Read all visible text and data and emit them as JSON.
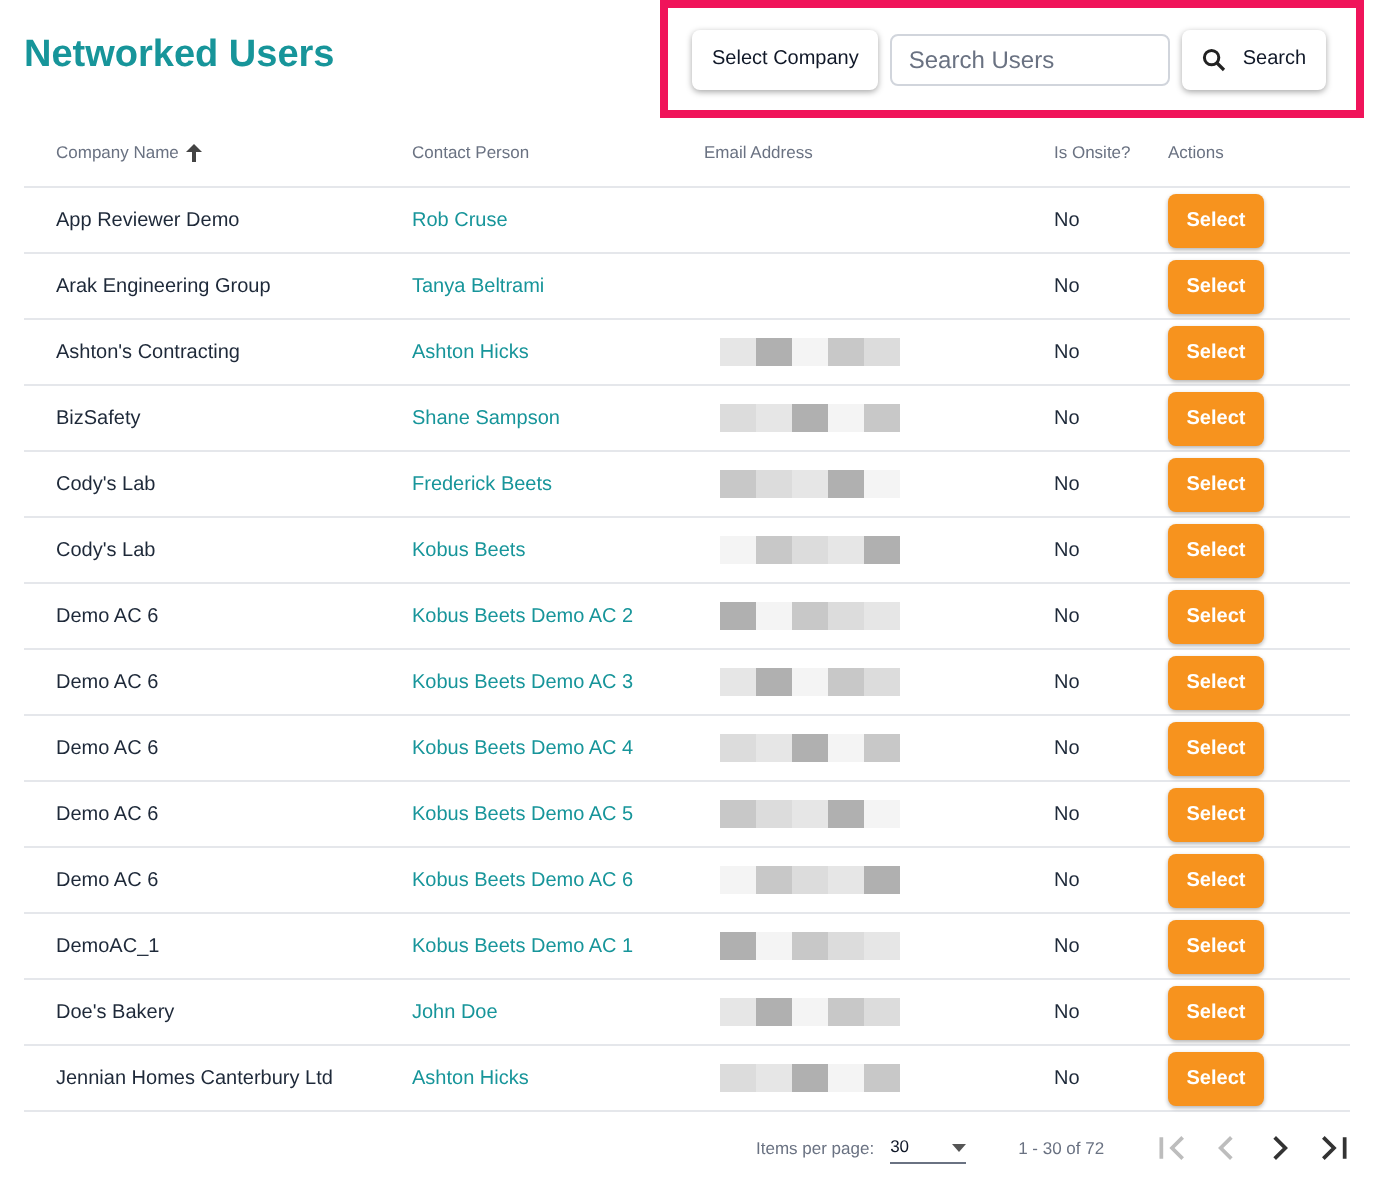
{
  "title": "Networked Users",
  "toolbar": {
    "select_company": "Select Company",
    "search": {
      "placeholder": "Search Users"
    },
    "search_button": "Search"
  },
  "table": {
    "columns": [
      {
        "label": "Company Name",
        "sorted": true
      },
      {
        "label": "Contact Person",
        "sorted": false
      },
      {
        "label": "Email Address",
        "sorted": false
      },
      {
        "label": "Is Onsite?",
        "sorted": false
      },
      {
        "label": "Actions",
        "sorted": false
      }
    ],
    "rows": [
      {
        "company": "App Reviewer Demo",
        "contact": "Rob Cruse",
        "onsite": "No",
        "action": "Select"
      },
      {
        "company": "Arak Engineering Group",
        "contact": "Tanya Beltrami",
        "onsite": "No",
        "action": "Select"
      },
      {
        "company": "Ashton's Contracting",
        "contact": "Ashton Hicks",
        "onsite": "No",
        "action": "Select"
      },
      {
        "company": "BizSafety",
        "contact": "Shane Sampson",
        "onsite": "No",
        "action": "Select"
      },
      {
        "company": "Cody's Lab",
        "contact": "Frederick Beets",
        "onsite": "No",
        "action": "Select"
      },
      {
        "company": "Cody's Lab",
        "contact": "Kobus Beets",
        "onsite": "No",
        "action": "Select"
      },
      {
        "company": "Demo AC 6",
        "contact": "Kobus Beets Demo AC 2",
        "onsite": "No",
        "action": "Select"
      },
      {
        "company": "Demo AC 6",
        "contact": "Kobus Beets Demo AC 3",
        "onsite": "No",
        "action": "Select"
      },
      {
        "company": "Demo AC 6",
        "contact": "Kobus Beets Demo AC 4",
        "onsite": "No",
        "action": "Select"
      },
      {
        "company": "Demo AC 6",
        "contact": "Kobus Beets Demo AC 5",
        "onsite": "No",
        "action": "Select"
      },
      {
        "company": "Demo AC 6",
        "contact": "Kobus Beets Demo AC 6",
        "onsite": "No",
        "action": "Select"
      },
      {
        "company": "DemoAC_1",
        "contact": "Kobus Beets Demo AC 1",
        "onsite": "No",
        "action": "Select"
      },
      {
        "company": "Doe's Bakery",
        "contact": "John Doe",
        "onsite": "No",
        "action": "Select"
      },
      {
        "company": "Jennian Homes Canterbury Ltd",
        "contact": "Ashton Hicks",
        "onsite": "No",
        "action": "Select"
      }
    ]
  },
  "paginator": {
    "items_per_page_label": "Items per page:",
    "page_size": "30",
    "range": "1 - 30 of 72",
    "buttons": [
      {
        "kind": "first",
        "disabled": true
      },
      {
        "kind": "prev",
        "disabled": true
      },
      {
        "kind": "next",
        "disabled": false
      },
      {
        "kind": "last",
        "disabled": false
      }
    ]
  }
}
